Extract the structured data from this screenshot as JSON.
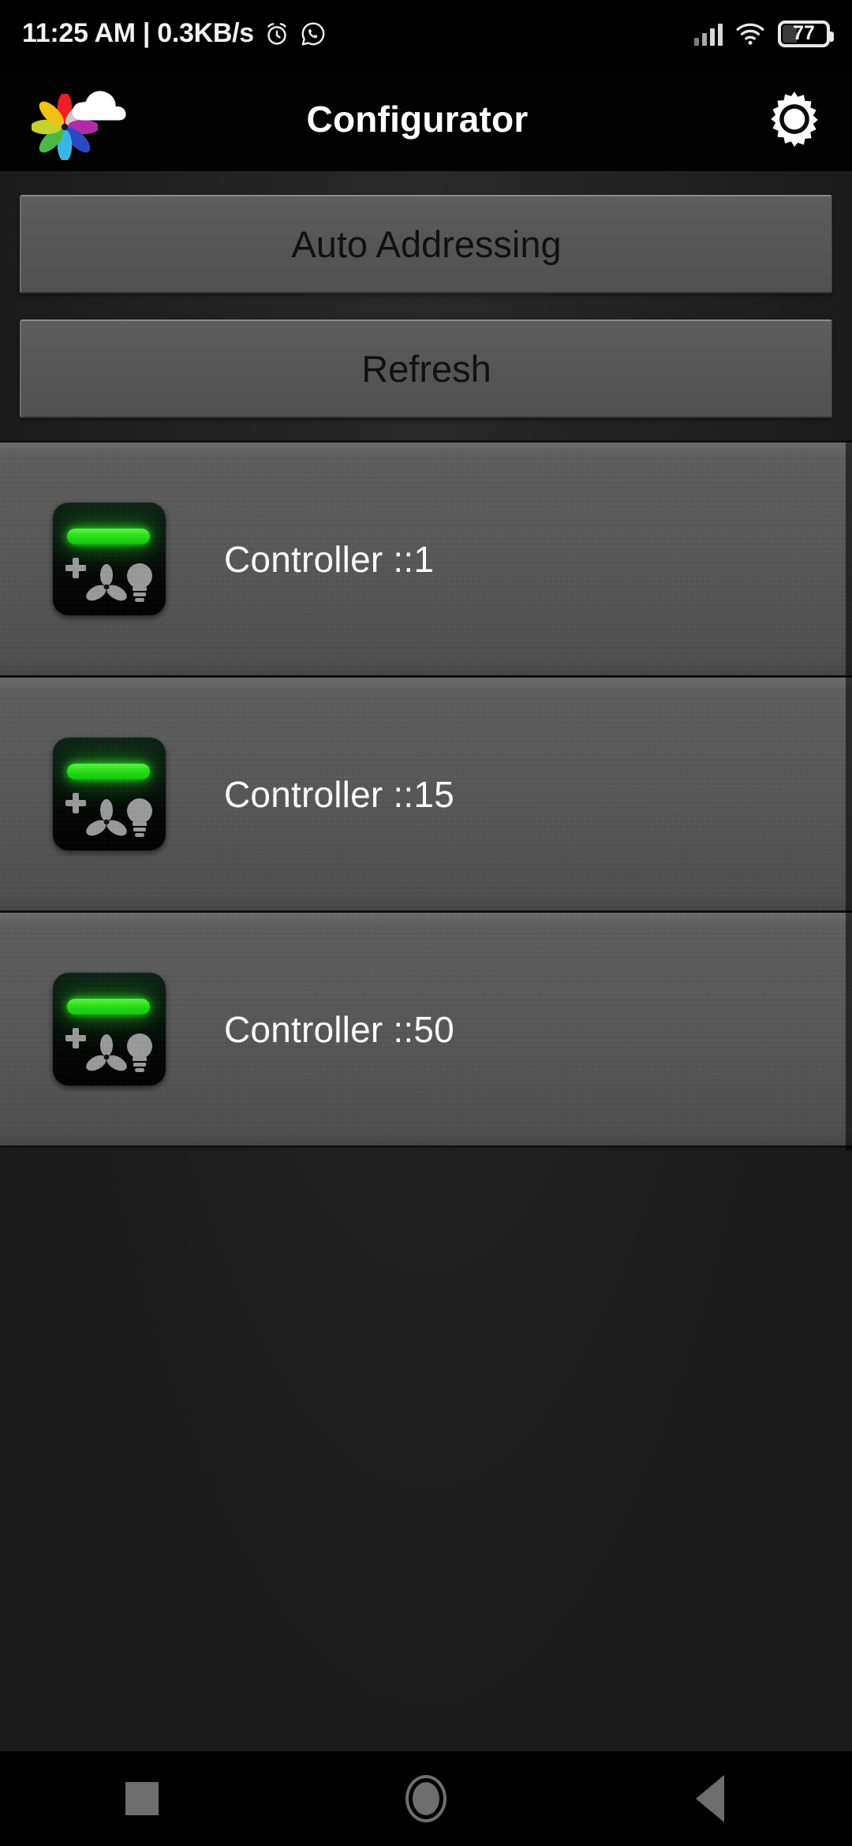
{
  "status_bar": {
    "time_and_speed": "11:25 AM | 0.3KB/s",
    "alarm_icon": "alarm-clock-icon",
    "whatsapp_icon": "whatsapp-icon",
    "signal_icon": "cellular-signal-icon",
    "wifi_icon": "wifi-icon",
    "battery_percent": "77"
  },
  "app_bar": {
    "logo_icon": "flower-cloud-logo-icon",
    "title": "Configurator",
    "settings_icon": "gear-icon"
  },
  "actions": {
    "auto_addressing_label": "Auto Addressing",
    "refresh_label": "Refresh"
  },
  "controllers": [
    {
      "label": "Controller ::1",
      "status_icon": "controller-device-icon",
      "led": "on"
    },
    {
      "label": "Controller ::15",
      "status_icon": "controller-device-icon",
      "led": "on"
    },
    {
      "label": "Controller ::50",
      "status_icon": "controller-device-icon",
      "led": "on"
    }
  ],
  "nav_bar": {
    "recents_icon": "square-recents-icon",
    "home_icon": "circle-home-icon",
    "back_icon": "triangle-back-icon"
  },
  "colors": {
    "led_green": "#23e015",
    "app_bar_bg": "#020202",
    "row_bg": "#565656",
    "button_bg": "#565656",
    "page_bg": "#1b1b1b"
  }
}
